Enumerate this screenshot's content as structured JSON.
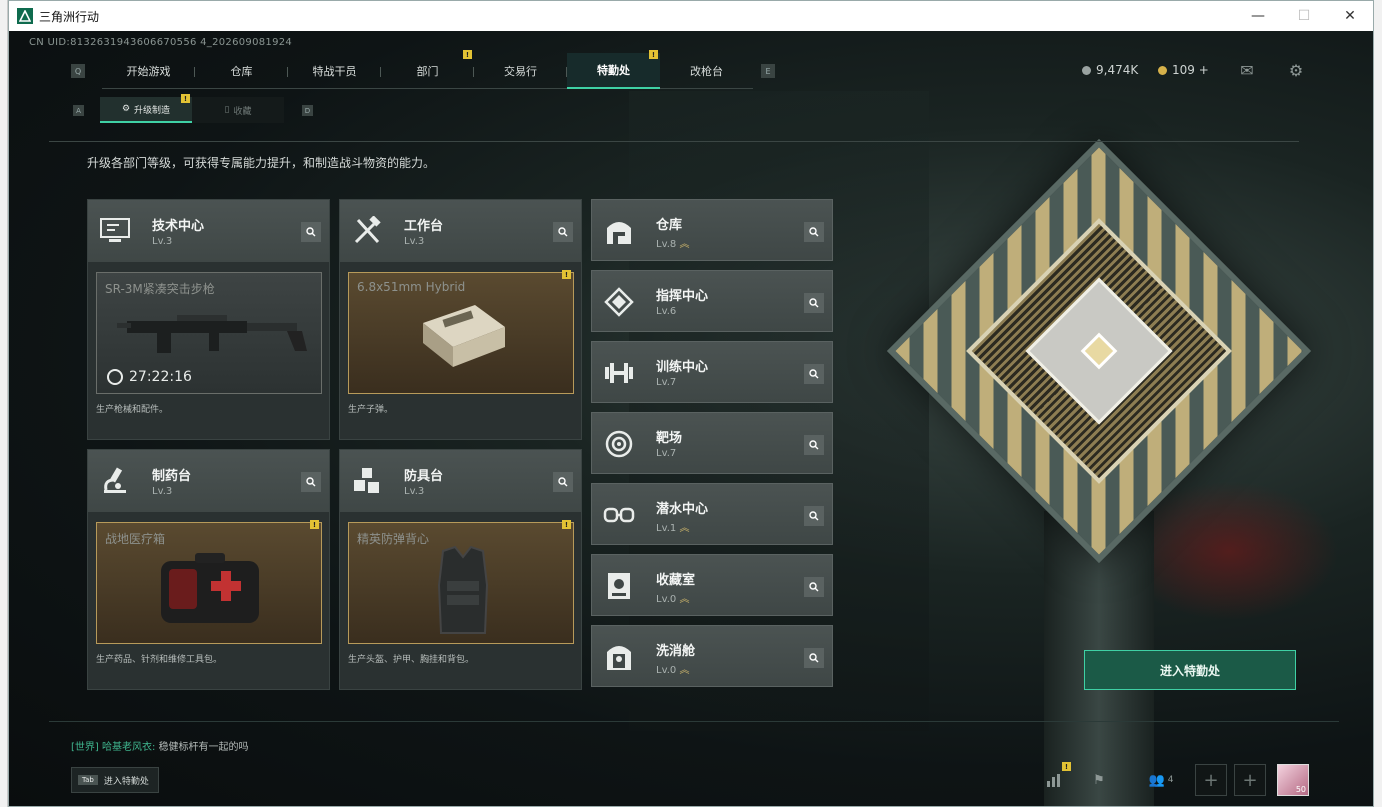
{
  "window": {
    "title": "三角洲行动"
  },
  "top": {
    "uid": "CN UID:8132631943606670556 4_202609081924",
    "nav_keys": {
      "left": "Q",
      "right": "E"
    },
    "tabs": [
      {
        "label": "开始游戏",
        "badge": ""
      },
      {
        "label": "仓库",
        "badge": ""
      },
      {
        "label": "特战干员",
        "badge": ""
      },
      {
        "label": "部门",
        "badge": "!"
      },
      {
        "label": "交易行",
        "badge": ""
      },
      {
        "label": "特勤处",
        "badge": "!"
      },
      {
        "label": "改枪台",
        "badge": ""
      }
    ],
    "active_tab": "特勤处",
    "currency_1": "9,474K",
    "currency_2": "109 +"
  },
  "sub": {
    "keys": {
      "left": "A",
      "right": "D"
    },
    "tabs": [
      {
        "label": "升级制造",
        "badge": "!"
      },
      {
        "label": "收藏",
        "badge": ""
      }
    ]
  },
  "description": "升级各部门等级，可获得专属能力提升，和制造战斗物资的能力。",
  "cards": [
    {
      "name": "技术中心",
      "level": "Lv.3",
      "product": "SR-3M紧凑突击步枪",
      "timer": "27:22:16",
      "footer": "生产枪械和配件。",
      "badge": ""
    },
    {
      "name": "工作台",
      "level": "Lv.3",
      "product": "6.8x51mm Hybrid",
      "timer": "",
      "footer": "生产子弹。",
      "badge": "!"
    },
    {
      "name": "制药台",
      "level": "Lv.3",
      "product": "战地医疗箱",
      "timer": "",
      "footer": "生产药品、针剂和维修工具包。",
      "badge": "!"
    },
    {
      "name": "防具台",
      "level": "Lv.3",
      "product": "精英防弹背心",
      "timer": "",
      "footer": "生产头盔、护甲、胸挂和背包。",
      "badge": "!"
    }
  ],
  "rows": [
    {
      "name": "仓库",
      "level": "Lv.8",
      "upgrade": true
    },
    {
      "name": "指挥中心",
      "level": "Lv.6",
      "upgrade": false
    },
    {
      "name": "训练中心",
      "level": "Lv.7",
      "upgrade": false
    },
    {
      "name": "靶场",
      "level": "Lv.7",
      "upgrade": false
    },
    {
      "name": "潜水中心",
      "level": "Lv.1",
      "upgrade": true
    },
    {
      "name": "收藏室",
      "level": "Lv.0",
      "upgrade": true
    },
    {
      "name": "洗消舱",
      "level": "Lv.0",
      "upgrade": true
    }
  ],
  "enter_button": "进入特勤处",
  "chat": {
    "channel": "[世界]",
    "user": "哈基老风衣:",
    "message": "稳健标杆有一起的吗"
  },
  "tab_hint": {
    "key": "Tab",
    "label": "进入特勤处"
  },
  "bottom": {
    "friends_count": "4",
    "avatar_level": "50"
  },
  "colors": {
    "accent": "#3fd1a5",
    "badge": "#e2c234"
  }
}
